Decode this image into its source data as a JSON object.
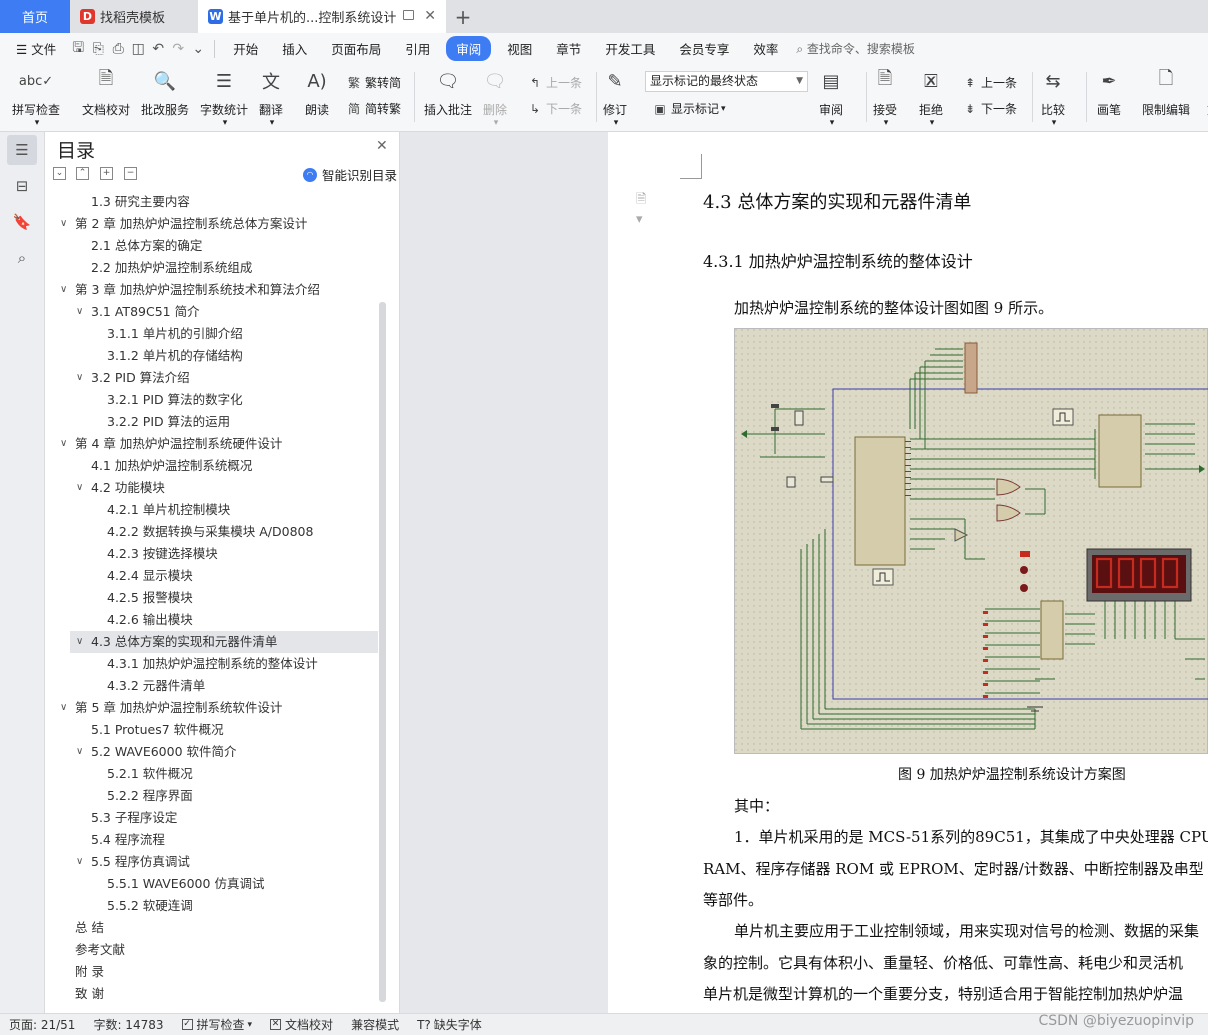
{
  "tabs": {
    "home": "首页",
    "template": "找稻壳模板",
    "doc": "基于单片机的...控制系统设计"
  },
  "menu": {
    "file": "文件",
    "items": [
      "开始",
      "插入",
      "页面布局",
      "引用",
      "审阅",
      "视图",
      "章节",
      "开发工具",
      "会员专享",
      "效率"
    ],
    "active": "审阅",
    "search": "查找命令、搜索模板"
  },
  "ribbon": {
    "spell": "拼写检查",
    "proof": "文档校对",
    "batch": "批改服务",
    "wordcount": "字数统计",
    "translate": "翻译",
    "read": "朗读",
    "t2s": "繁转简",
    "s2t": "简转繁",
    "insert_comment": "插入批注",
    "delete": "删除",
    "prev": "上一条",
    "next": "下一条",
    "revise": "修订",
    "markup_state": "显示标记的最终状态",
    "show_markup": "显示标记",
    "review": "审阅",
    "accept": "接受",
    "reject": "拒绝",
    "prev2": "上一条",
    "next2": "下一条",
    "compare": "比较",
    "pen": "画笔",
    "restrict": "限制编辑",
    "doc_trunc": "文"
  },
  "toc": {
    "title": "目录",
    "smart": "智能识别目录",
    "items": [
      {
        "text": "1.3 研究主要内容",
        "level": 2
      },
      {
        "text": "第 2 章  加热炉炉温控制系统总体方案设计",
        "level": 1,
        "caret": true
      },
      {
        "text": "2.1 总体方案的确定",
        "level": 2
      },
      {
        "text": "2.2 加热炉炉温控制系统组成",
        "level": 2
      },
      {
        "text": "第 3 章  加热炉炉温控制系统技术和算法介绍",
        "level": 1,
        "caret": true
      },
      {
        "text": "3.1 AT89C51 简介",
        "level": 2,
        "caret": true
      },
      {
        "text": "3.1.1 单片机的引脚介绍",
        "level": 3
      },
      {
        "text": "3.1.2 单片机的存储结构",
        "level": 3
      },
      {
        "text": "3.2 PID 算法介绍",
        "level": 2,
        "caret": true
      },
      {
        "text": "3.2.1 PID 算法的数字化",
        "level": 3
      },
      {
        "text": "3.2.2 PID 算法的运用",
        "level": 3
      },
      {
        "text": "第 4 章  加热炉炉温控制系统硬件设计",
        "level": 1,
        "caret": true
      },
      {
        "text": "4.1 加热炉炉温控制系统概况",
        "level": 2
      },
      {
        "text": "4.2 功能模块",
        "level": 2,
        "caret": true
      },
      {
        "text": "4.2.1 单片机控制模块",
        "level": 3
      },
      {
        "text": "4.2.2 数据转换与采集模块 A/D0808",
        "level": 3
      },
      {
        "text": "4.2.3 按键选择模块",
        "level": 3
      },
      {
        "text": "4.2.4 显示模块",
        "level": 3
      },
      {
        "text": "4.2.5 报警模块",
        "level": 3
      },
      {
        "text": "4.2.6 输出模块",
        "level": 3
      },
      {
        "text": "4.3 总体方案的实现和元器件清单",
        "level": 2,
        "caret": true,
        "selected": true
      },
      {
        "text": "4.3.1 加热炉炉温控制系统的整体设计",
        "level": 3
      },
      {
        "text": "4.3.2 元器件清单",
        "level": 3
      },
      {
        "text": "第 5 章  加热炉炉温控制系统软件设计",
        "level": 1,
        "caret": true
      },
      {
        "text": "5.1 Protues7 软件概况",
        "level": 2
      },
      {
        "text": "5.2 WAVE6000 软件简介",
        "level": 2,
        "caret": true
      },
      {
        "text": "5.2.1 软件概况",
        "level": 3
      },
      {
        "text": "5.2.2 程序界面",
        "level": 3
      },
      {
        "text": "5.3 子程序设定",
        "level": 2
      },
      {
        "text": "5.4 程序流程",
        "level": 2
      },
      {
        "text": "5.5 程序仿真调试",
        "level": 2,
        "caret": true
      },
      {
        "text": "5.5.1 WAVE6000 仿真调试",
        "level": 3
      },
      {
        "text": "5.5.2 软硬连调",
        "level": 3
      },
      {
        "text": "总    结",
        "level": 1
      },
      {
        "text": "参考文献",
        "level": 1
      },
      {
        "text": "附    录",
        "level": 1
      },
      {
        "text": "致    谢",
        "level": 1
      }
    ]
  },
  "document": {
    "h3": "4.3 总体方案的实现和元器件清单",
    "h4": "4.3.1 加热炉炉温控制系统的整体设计",
    "p1": "加热炉炉温控制系统的整体设计图如图 9 所示。",
    "caption": "图 9  加热炉炉温控制系统设计方案图",
    "p2": "其中：",
    "p3": "1．单片机采用的是 MCS-51系列的89C51，其集成了中央处理器 CPU",
    "p4": "RAM、程序存储器 ROM 或 EPROM、定时器/计数器、中断控制器及串型",
    "p5": "等部件。",
    "p6": "单片机主要应用于工业控制领域，用来实现对信号的检测、数据的采集",
    "p7": "象的控制。它具有体积小、重量轻、价格低、可靠性高、耗电少和灵活机",
    "p8": "单片机是微型计算机的一个重要分支，特别适合用于智能控制加热炉炉温"
  },
  "status": {
    "page": "页面: 21/51",
    "words": "字数: 14783",
    "spell": "拼写检查",
    "proof": "文档校对",
    "compat": "兼容模式",
    "font": "缺失字体",
    "watermark": "CSDN @biyezuopinvip"
  },
  "colors": {
    "accent": "#3d7cf2",
    "schematic_bg": "#dcdac6",
    "wire": "#2e6b2e",
    "display_red": "#c62b1f"
  }
}
